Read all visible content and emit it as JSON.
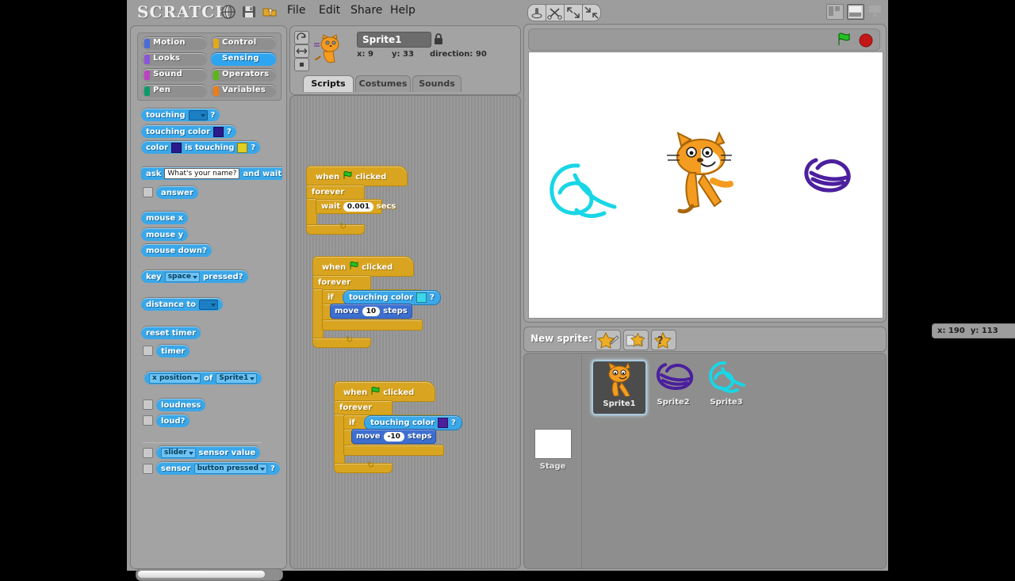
{
  "app": {
    "logo": "SCRATCH"
  },
  "menu": {
    "icons": [
      {
        "name": "globe-icon",
        "label": "language"
      },
      {
        "name": "save-icon",
        "label": "save"
      },
      {
        "name": "open-project-icon",
        "label": "open"
      }
    ],
    "items": [
      "File",
      "Edit",
      "Share",
      "Help"
    ],
    "view_buttons": [
      "small-stage-view",
      "normal-stage-view",
      "presentation-view"
    ],
    "selected_view": "normal-stage-view"
  },
  "palette": {
    "categories": [
      {
        "label": "Motion",
        "color": "#4a6cd4"
      },
      {
        "label": "Control",
        "color": "#e1a91a"
      },
      {
        "label": "Looks",
        "color": "#8a55d7"
      },
      {
        "label": "Sensing",
        "color": "#2ca5e2"
      },
      {
        "label": "Sound",
        "color": "#bb42c3"
      },
      {
        "label": "Operators",
        "color": "#5cb712"
      },
      {
        "label": "Pen",
        "color": "#0e9a6c"
      },
      {
        "label": "Variables",
        "color": "#ee7d16"
      }
    ],
    "selected_category": "Sensing",
    "blocks": [
      {
        "id": "touching",
        "parts": [
          "touching",
          "[dropdown]",
          "?"
        ]
      },
      {
        "id": "touching-color",
        "parts": [
          "touching color",
          "[color:#2a1a8c]",
          "?"
        ]
      },
      {
        "id": "color-is-touching",
        "parts": [
          "color",
          "[color:#2a1a8c]",
          "is touching",
          "[color:#e3cf1e]",
          "?"
        ]
      },
      {
        "id": "ask-and-wait",
        "parts": [
          "ask",
          "[field:What's your name?]",
          "and wait"
        ]
      },
      {
        "id": "answer",
        "parts": [
          "answer"
        ],
        "checkbox": true
      },
      {
        "id": "mouse-x",
        "parts": [
          "mouse x"
        ]
      },
      {
        "id": "mouse-y",
        "parts": [
          "mouse y"
        ]
      },
      {
        "id": "mouse-down",
        "parts": [
          "mouse down?"
        ]
      },
      {
        "id": "key-pressed",
        "parts": [
          "key",
          "[menu:space]",
          "pressed?"
        ]
      },
      {
        "id": "distance-to",
        "parts": [
          "distance to",
          "[dropdown]"
        ]
      },
      {
        "id": "reset-timer",
        "parts": [
          "reset timer"
        ]
      },
      {
        "id": "timer",
        "parts": [
          "timer"
        ],
        "checkbox": true
      },
      {
        "id": "attribute-of",
        "parts": [
          "[menu:x position]",
          "of",
          "[menu:Sprite1]"
        ]
      },
      {
        "id": "loudness",
        "parts": [
          "loudness"
        ],
        "checkbox": true
      },
      {
        "id": "loud",
        "parts": [
          "loud?"
        ],
        "checkbox": true
      },
      {
        "id": "sensor-value",
        "parts": [
          "[menu:slider]",
          "sensor value"
        ],
        "checkbox": true
      },
      {
        "id": "sensor-pressed",
        "parts": [
          "sensor",
          "[menu:button pressed]",
          "?"
        ],
        "checkbox": true
      }
    ],
    "block_labels": {
      "touching": "touching",
      "touching_color": "touching color",
      "color": "color",
      "is_touching": "is touching",
      "question": "?",
      "ask": "ask",
      "ask_value": "What's your name?",
      "and_wait": "and wait",
      "answer": "answer",
      "mouse_x": "mouse x",
      "mouse_y": "mouse y",
      "mouse_down": "mouse down?",
      "key": "key",
      "key_option": "space",
      "pressed": "pressed?",
      "distance_to": "distance to",
      "reset_timer": "reset timer",
      "timer": "timer",
      "x_position": "x position",
      "of": "of",
      "sprite1": "Sprite1",
      "loudness": "loudness",
      "loud": "loud?",
      "slider": "slider",
      "sensor_value": "sensor value",
      "sensor": "sensor",
      "button_pressed": "button pressed"
    }
  },
  "sprite_header": {
    "name": "Sprite1",
    "x_label": "x:",
    "x_value": "9",
    "y_label": "y:",
    "y_value": "33",
    "direction_label": "direction:",
    "direction_value": "90",
    "rotation_buttons": [
      "rotate-freely-button",
      "flip-left-right-button",
      "do-not-rotate-button"
    ],
    "lock": "lock-icon",
    "tabs": [
      {
        "label": "Scripts",
        "active": true
      },
      {
        "label": "Costumes",
        "active": false
      },
      {
        "label": "Sounds",
        "active": false
      }
    ]
  },
  "scripts": [
    {
      "id": "script-1",
      "hat": {
        "when": "when",
        "flag": "green-flag-icon",
        "clicked": "clicked"
      },
      "loop": "forever",
      "body": [
        {
          "type": "wait",
          "pre": "wait",
          "value": "0.001",
          "post": "secs"
        }
      ]
    },
    {
      "id": "script-2",
      "hat": {
        "when": "when",
        "flag": "green-flag-icon",
        "clicked": "clicked"
      },
      "loop": "forever",
      "if_label": "if",
      "condition": {
        "label": "touching color",
        "color": "#3dd6e8",
        "q": "?"
      },
      "body": [
        {
          "type": "move",
          "pre": "move",
          "value": "10",
          "post": "steps"
        }
      ]
    },
    {
      "id": "script-3",
      "hat": {
        "when": "when",
        "flag": "green-flag-icon",
        "clicked": "clicked"
      },
      "loop": "forever",
      "if_label": "if",
      "condition": {
        "label": "touching color",
        "color": "#4b1f9e",
        "q": "?"
      },
      "body": [
        {
          "type": "move",
          "pre": "move",
          "value": "-10",
          "post": "steps"
        }
      ]
    }
  ],
  "stage": {
    "toolbar": [
      "duplicate-tool",
      "scissors-tool",
      "grow-tool",
      "shrink-tool"
    ],
    "controls": [
      "green-flag-button",
      "stop-button"
    ],
    "mouse_x_label": "x:",
    "mouse_x": "190",
    "mouse_y_label": "y:",
    "mouse_y": "113",
    "objects": [
      {
        "name": "cyan-scribble",
        "color": "#18d6e6"
      },
      {
        "name": "scratch-cat",
        "color": "#f49c20"
      },
      {
        "name": "purple-scribble",
        "color": "#4b1f9e"
      }
    ]
  },
  "corral": {
    "new_sprite_label": "New sprite:",
    "new_sprite_buttons": [
      "paint-new-sprite",
      "open-sprite-file",
      "random-sprite"
    ],
    "stage_label": "Stage",
    "sprites": [
      {
        "name": "Sprite1",
        "selected": true,
        "art": "cat"
      },
      {
        "name": "Sprite2",
        "selected": false,
        "art": "purple"
      },
      {
        "name": "Sprite3",
        "selected": false,
        "art": "cyan"
      }
    ]
  }
}
